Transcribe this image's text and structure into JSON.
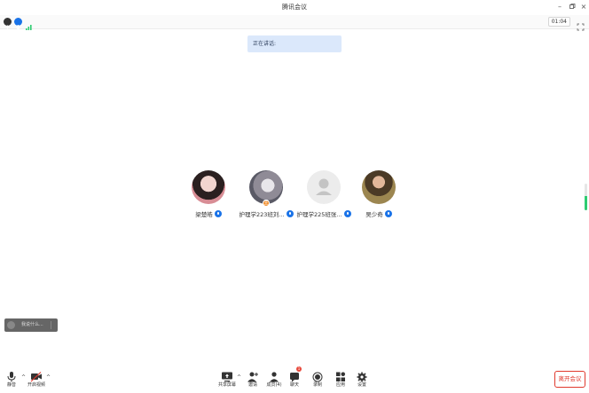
{
  "window": {
    "title": "腾讯会议"
  },
  "info": {
    "timer": "01:04"
  },
  "speaking": {
    "label": "正在讲话:"
  },
  "participants": [
    {
      "name": "梁楚皓",
      "color": "#c9898a"
    },
    {
      "name": "护理学223班刘...",
      "color": "#9e9aa5",
      "badge": "主"
    },
    {
      "name": "护理学225班张...",
      "color": "#e8e8e8"
    },
    {
      "name": "吴少奇",
      "color": "#7a6a45"
    }
  ],
  "toast": {
    "text": "我说什么..."
  },
  "toolbar": {
    "mute_label": "静音",
    "video_label": "开启视频",
    "share_label": "共享屏幕",
    "invite_label": "邀请",
    "members_label": "成员(4)",
    "chat_label": "聊天",
    "chat_badge": "1",
    "record_label": "录制",
    "apps_label": "应用",
    "settings_label": "设置",
    "leave_label": "离开会议"
  },
  "colors": {
    "accent": "#1a73e8",
    "danger": "#e0392d",
    "banner": "#dbe8fb"
  }
}
